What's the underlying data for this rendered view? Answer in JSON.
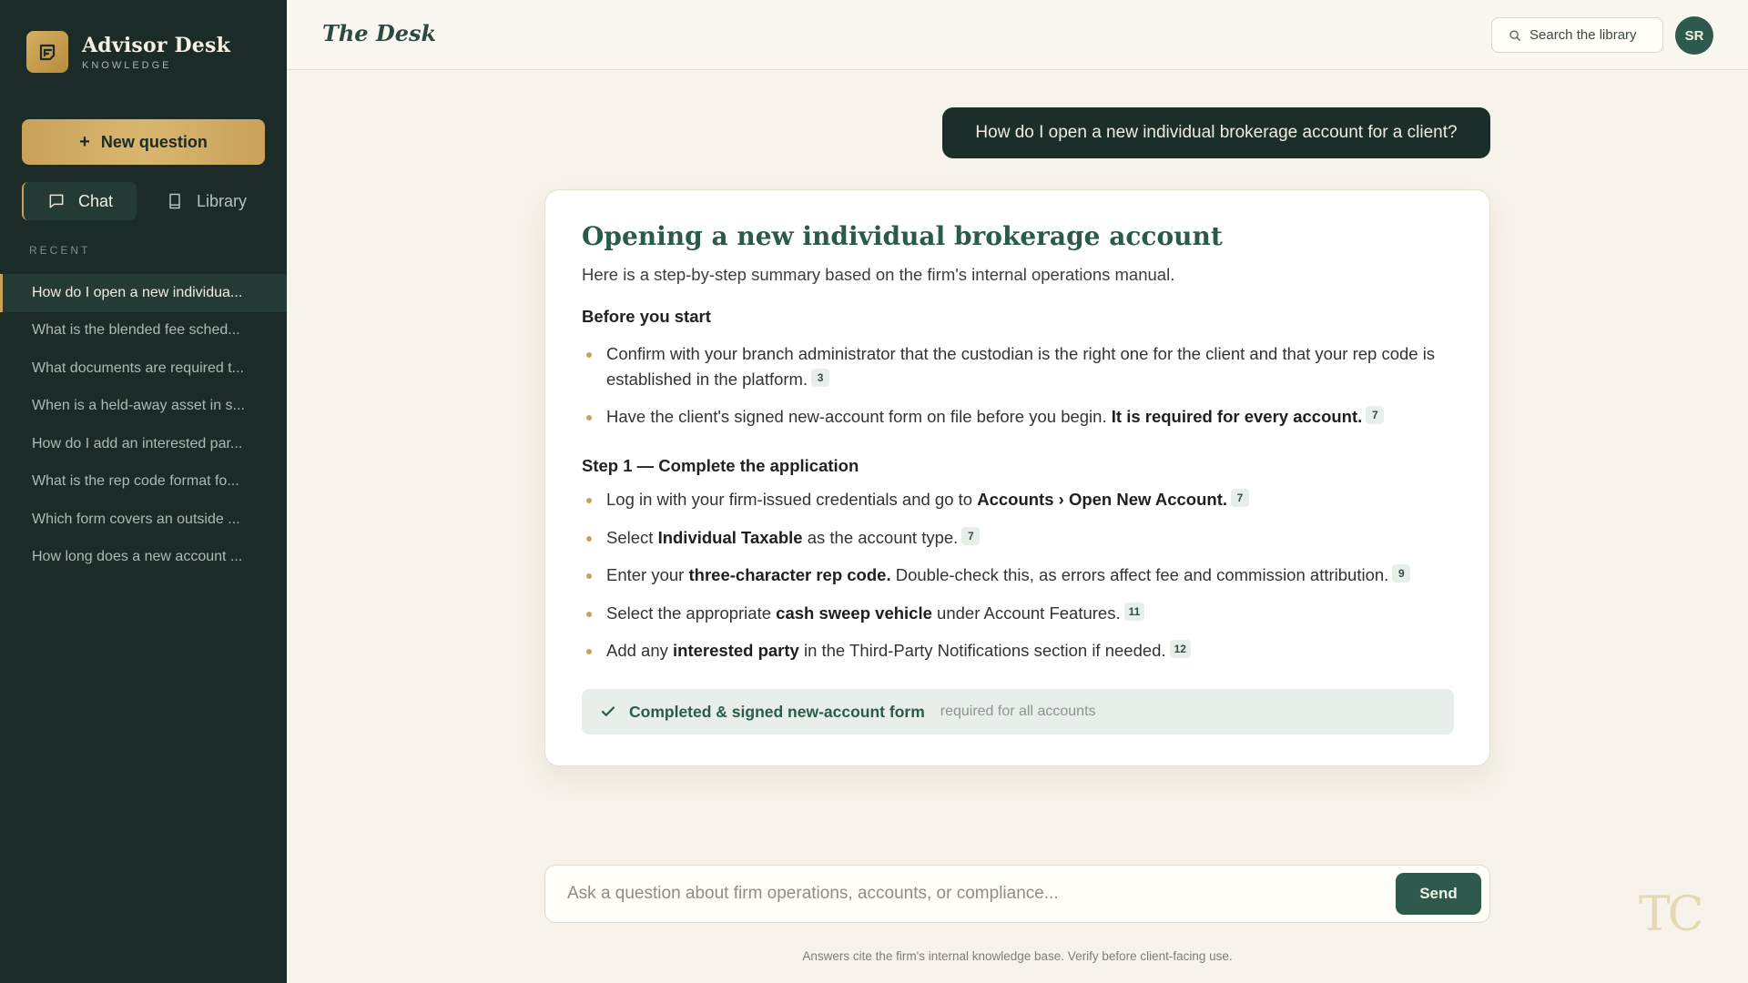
{
  "brand": {
    "title": "Advisor Desk",
    "subtitle": "KNOWLEDGE",
    "logo_icon": "note-card-icon",
    "accent_color": "#c9a25a"
  },
  "sidebar": {
    "new_question_label": "New question",
    "tabs": [
      {
        "label": "Chat",
        "icon": "chat-bubble-icon",
        "active": true
      },
      {
        "label": "Library",
        "icon": "book-icon",
        "active": false
      }
    ],
    "recent_label": "RECENT",
    "recent": [
      "How do I open a new individua...",
      "What is the blended fee sched...",
      "What documents are required t...",
      "When is a held-away asset in s...",
      "How do I add an interested par...",
      "What is the rep code format fo...",
      "Which form covers an outside ...",
      "How long does a new account ..."
    ],
    "background_color": "#1b2b27"
  },
  "topbar": {
    "title": "The Desk",
    "search_label": "Search the library",
    "avatar_initials": "SR"
  },
  "chat": {
    "user_message": "How do I open a new individual brokerage account for a client?",
    "answer": {
      "title": "Opening a new individual brokerage account",
      "intro": "Here is a step-by-step summary based on the firm's internal operations manual.",
      "section1_heading": "Before you start",
      "section1_items": [
        {
          "pre": "Confirm with your branch administrator that the custodian is the right one for the client and that your rep code is established in the platform.",
          "bold": "",
          "post": "",
          "cite": "3"
        },
        {
          "pre": "Have the client's signed new-account form on file before you begin. ",
          "bold": "It is required for every account.",
          "post": "",
          "cite": "7"
        }
      ],
      "section2_heading": "Step 1 — Complete the application",
      "section2_items": [
        {
          "pre": "Log in with your firm-issued credentials and go to ",
          "bold": "Accounts › Open New Account.",
          "post": "",
          "cite": "7"
        },
        {
          "pre": "Select ",
          "bold": "Individual Taxable",
          "post": " as the account type.",
          "cite": "7"
        },
        {
          "pre": "Enter your ",
          "bold": "three-character rep code.",
          "post": " Double-check this, as errors affect fee and commission attribution.",
          "cite": "9"
        },
        {
          "pre": "Select the appropriate ",
          "bold": "cash sweep vehicle",
          "post": " under Account Features.",
          "cite": "11"
        },
        {
          "pre": "Add any ",
          "bold": "interested party",
          "post": " in the Third-Party Notifications section if needed.",
          "cite": "12"
        }
      ],
      "checklist": {
        "main": "Completed & signed new-account form",
        "note": "required for all accounts"
      }
    }
  },
  "composer": {
    "placeholder": "Ask a question about firm operations, accounts, or compliance...",
    "send_label": "Send"
  },
  "disclaimer": "Answers cite the firm's internal knowledge base. Verify before client-facing use.",
  "watermark": "TC"
}
